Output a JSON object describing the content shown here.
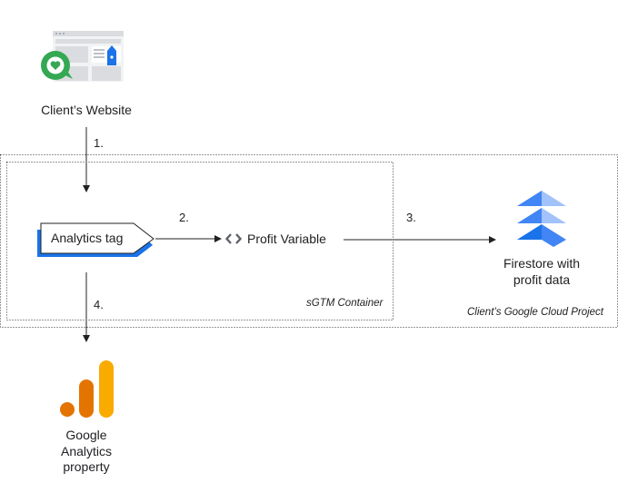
{
  "website": {
    "label": "Client’s Website"
  },
  "steps": {
    "s1": "1.",
    "s2": "2.",
    "s3": "3.",
    "s4": "4."
  },
  "analytics_tag": {
    "label": "Analytics tag"
  },
  "profit_variable": {
    "label": "Profit Variable"
  },
  "firestore": {
    "line1": "Firestore with",
    "line2": "profit data"
  },
  "sgtm_container": {
    "label": "sGTM Container"
  },
  "cloud_project": {
    "label": "Client’s Google Cloud Project"
  },
  "ga_property": {
    "line1": "Google",
    "line2": "Analytics",
    "line3": "property"
  },
  "colors": {
    "tag_blue": "#1a73e8",
    "firestore_blue": "#4285f4",
    "ga_orange": "#e37400",
    "ga_yellow": "#f9ab00",
    "web_green": "#34a853"
  },
  "icons": {
    "website": "website-icon",
    "code": "code-brackets-icon",
    "firestore": "firestore-icon",
    "analytics": "google-analytics-icon"
  }
}
